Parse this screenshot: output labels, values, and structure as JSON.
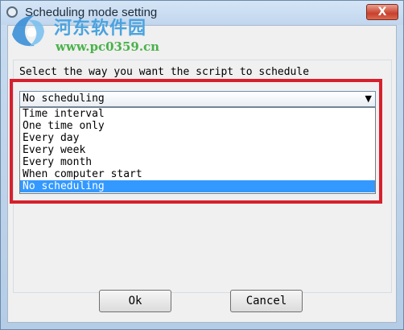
{
  "window": {
    "title": "Scheduling mode setting",
    "close_glyph": "X"
  },
  "watermark": {
    "chinese_text": "河东软件园",
    "url": "www.pc0359.cn",
    "colors": {
      "logo": "#3b8fd6",
      "cn_text": "#4aa3df",
      "url_text": "#49b24a"
    }
  },
  "dialog": {
    "prompt": "Select the way you want the script to schedule",
    "select": {
      "value": "No scheduling",
      "arrow_icon": "triangle-down"
    },
    "options": [
      {
        "label": "Time interval",
        "selected": false
      },
      {
        "label": "One time only",
        "selected": false
      },
      {
        "label": "Every day",
        "selected": false
      },
      {
        "label": "Every week",
        "selected": false
      },
      {
        "label": "Every month",
        "selected": false
      },
      {
        "label": "When computer start",
        "selected": false
      },
      {
        "label": "No scheduling",
        "selected": true
      }
    ],
    "highlight_color": "#d6202c",
    "selection_color": "#3399ff"
  },
  "buttons": {
    "ok_label": "Ok",
    "cancel_label": "Cancel"
  }
}
